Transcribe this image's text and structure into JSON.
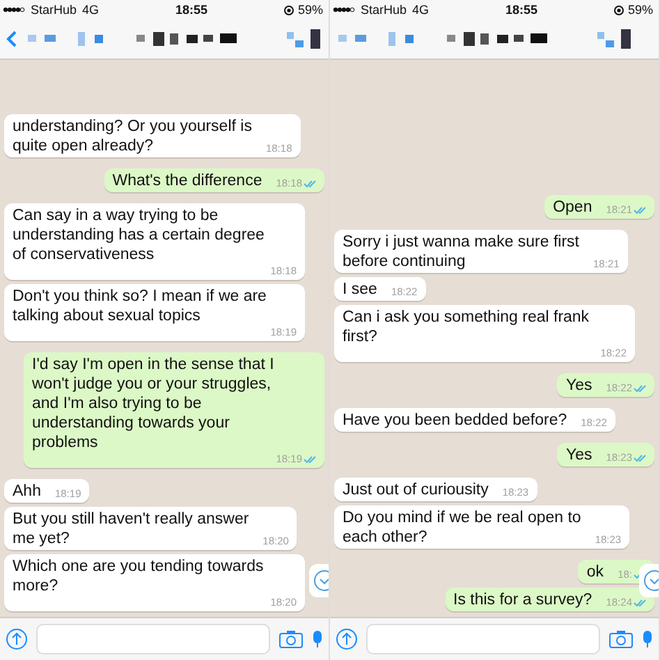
{
  "panels": [
    {
      "status_bar": {
        "carrier": "StarHub",
        "network": "4G",
        "time": "18:55",
        "battery": "59%"
      },
      "header": {
        "back": true
      },
      "messages": [
        {
          "kind": "received",
          "text": "understanding? Or you yourself is\nquite open already?",
          "time": "18:18"
        },
        {
          "kind": "sent",
          "text": "What's the difference",
          "time": "18:18"
        },
        {
          "kind": "received",
          "text": "Can say in a way trying to be\nunderstanding has a certain degree\nof conservativeness",
          "time": "18:18"
        },
        {
          "kind": "received",
          "text": "Don't you think so? I mean if we are\ntalking about sexual topics",
          "time": "18:19"
        },
        {
          "kind": "sent",
          "text": "I'd say I'm open in the sense that I\nwon't judge you or your struggles,\nand I'm also trying to be\nunderstanding towards your\nproblems",
          "time": "18:19"
        },
        {
          "kind": "received",
          "text": "Ahh",
          "time": "18:19"
        },
        {
          "kind": "received",
          "text": "But you still haven't really answer\nme yet?",
          "time": "18:20"
        },
        {
          "kind": "received",
          "text": "Which one are you tending towards\nmore?",
          "time": "18:20"
        }
      ]
    },
    {
      "status_bar": {
        "carrier": "StarHub",
        "network": "4G",
        "time": "18:55",
        "battery": "59%"
      },
      "header": {
        "back": false
      },
      "messages": [
        {
          "kind": "sent",
          "text": "Open",
          "time": "18:21"
        },
        {
          "kind": "received",
          "text": "Sorry i just wanna make sure first\nbefore continuing",
          "time": "18:21"
        },
        {
          "kind": "received",
          "text": "I see",
          "time": "18:22"
        },
        {
          "kind": "received",
          "text": "Can i ask you something real frank\nfirst?",
          "time": "18:22"
        },
        {
          "kind": "sent",
          "text": "Yes",
          "time": "18:22"
        },
        {
          "kind": "received",
          "text": "Have you been bedded before?",
          "time": "18:22"
        },
        {
          "kind": "sent",
          "text": "Yes",
          "time": "18:23"
        },
        {
          "kind": "received",
          "text": "Just out of curiousity",
          "time": "18:23"
        },
        {
          "kind": "received",
          "text": "Do you mind if we be real open to\neach other?",
          "time": "18:23"
        },
        {
          "kind": "sent",
          "text": "ok",
          "time": "18:"
        },
        {
          "kind": "sent",
          "text": "Is this for a survey?",
          "time": "18:24"
        }
      ]
    }
  ]
}
